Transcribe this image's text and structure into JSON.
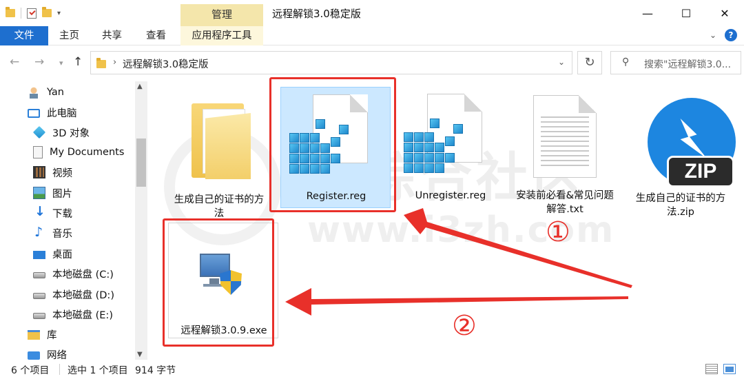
{
  "window": {
    "title": "远程解锁3.0稳定版",
    "context_tab": "管理",
    "controls": {
      "minimize": "—",
      "maximize": "☐",
      "close": "✕"
    }
  },
  "ribbon": {
    "tabs": [
      {
        "label": "文件"
      },
      {
        "label": "主页"
      },
      {
        "label": "共享"
      },
      {
        "label": "查看"
      },
      {
        "label": "应用程序工具"
      }
    ]
  },
  "address": {
    "path": "远程解锁3.0稳定版",
    "search_placeholder": "搜索\"远程解锁3.0..."
  },
  "nav": {
    "items": [
      {
        "label": "Yan",
        "icon": "user-icon"
      },
      {
        "label": "此电脑",
        "icon": "pc-icon"
      },
      {
        "label": "3D 对象",
        "icon": "cube-icon"
      },
      {
        "label": "My Documents",
        "icon": "document-icon"
      },
      {
        "label": "视频",
        "icon": "video-icon"
      },
      {
        "label": "图片",
        "icon": "picture-icon"
      },
      {
        "label": "下载",
        "icon": "download-icon"
      },
      {
        "label": "音乐",
        "icon": "music-icon"
      },
      {
        "label": "桌面",
        "icon": "desktop-icon"
      },
      {
        "label": "本地磁盘 (C:)",
        "icon": "disk-icon"
      },
      {
        "label": "本地磁盘 (D:)",
        "icon": "disk-icon"
      },
      {
        "label": "本地磁盘 (E:)",
        "icon": "disk-icon"
      },
      {
        "label": "库",
        "icon": "library-icon"
      },
      {
        "label": "网络",
        "icon": "network-icon"
      }
    ]
  },
  "files": [
    {
      "name_line1": "生成自己的证书的方",
      "name_line2": "法",
      "type": "folder"
    },
    {
      "name_line1": "Register.reg",
      "type": "reg",
      "selected": true
    },
    {
      "name_line1": "Unregister.reg",
      "type": "reg"
    },
    {
      "name_line1": "安装前必看&常见问题",
      "name_line2": "解答.txt",
      "type": "txt"
    },
    {
      "name_line1": "生成自己的证书的方",
      "name_line2": "法.zip",
      "type": "zip"
    },
    {
      "name_line1": "远程解锁3.0.9.exe",
      "type": "exe"
    }
  ],
  "annotations": {
    "step1": "①",
    "step2": "②"
  },
  "watermark": {
    "text": "i3综合社区",
    "url": "www.i3zh.com"
  },
  "status": {
    "count": "6 个项目",
    "selection": "选中 1 个项目",
    "size": "914 字节"
  },
  "colors": {
    "accent": "#1e6fcf",
    "manage_tab": "#f4e6ab",
    "selection": "#cce8ff",
    "annotation_red": "#e8302a"
  }
}
